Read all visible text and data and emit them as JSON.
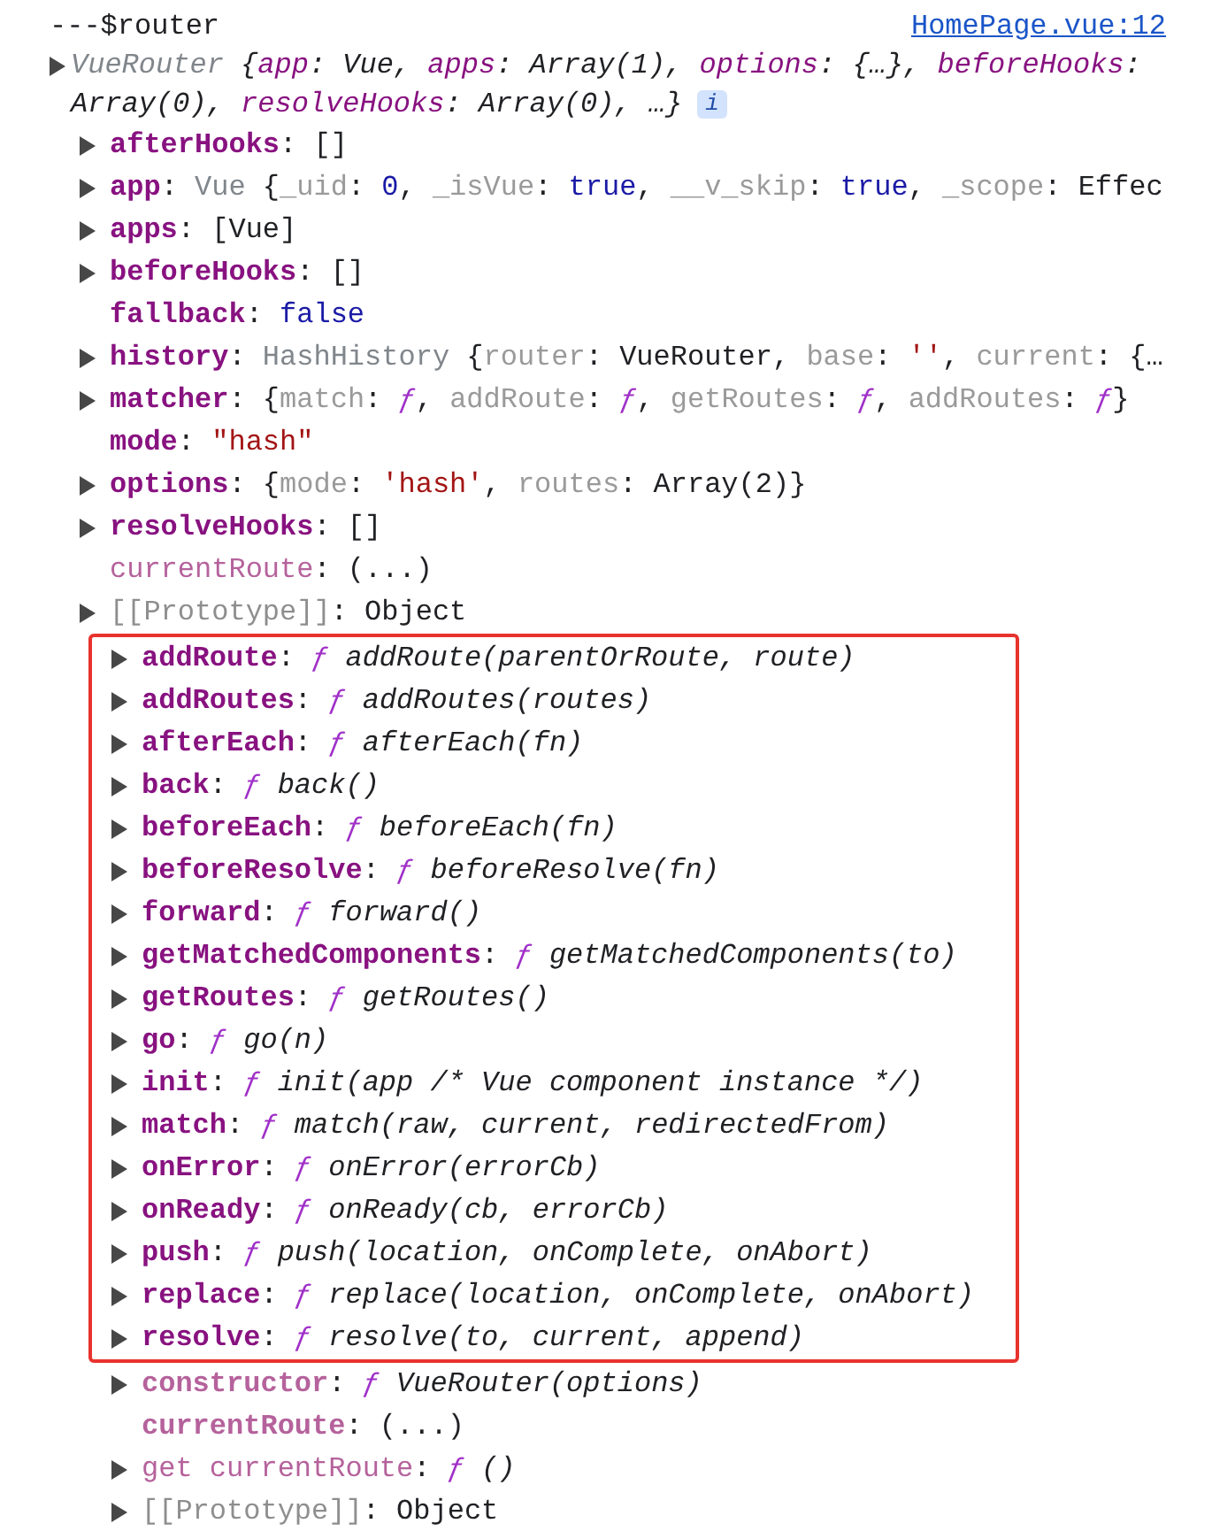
{
  "log": {
    "message": "---$router",
    "source": "HomePage.vue:12"
  },
  "object": {
    "preview_lines": [
      [
        {
          "kind": "t",
          "text": "VueRouter"
        },
        {
          "kind": "p",
          "text": " {"
        },
        {
          "kind": "pk",
          "text": "app"
        },
        {
          "kind": "p",
          "text": ": Vue, "
        },
        {
          "kind": "pk",
          "text": "apps"
        },
        {
          "kind": "p",
          "text": ": Array(1), "
        },
        {
          "kind": "pk",
          "text": "options"
        },
        {
          "kind": "p",
          "text": ": {…}, "
        },
        {
          "kind": "pk",
          "text": "beforeHooks"
        },
        {
          "kind": "p",
          "text": ":"
        }
      ],
      [
        {
          "kind": "p",
          "text": "Array(0), "
        },
        {
          "kind": "pk",
          "text": "resolveHooks"
        },
        {
          "kind": "p",
          "text": ": Array(0), …}"
        }
      ]
    ],
    "info_badge": "i",
    "children": [
      {
        "key": "afterHooks",
        "kind": "own",
        "expandable": true,
        "value": [
          {
            "kind": "p",
            "text": ": []"
          }
        ]
      },
      {
        "key": "app",
        "kind": "own",
        "expandable": true,
        "value": [
          {
            "kind": "p",
            "text": ": "
          },
          {
            "kind": "t",
            "text": "Vue"
          },
          {
            "kind": "p",
            "text": " {"
          },
          {
            "kind": "k",
            "text": "_uid"
          },
          {
            "kind": "p",
            "text": ": "
          },
          {
            "kind": "n",
            "text": "0"
          },
          {
            "kind": "p",
            "text": ", "
          },
          {
            "kind": "k",
            "text": "_isVue"
          },
          {
            "kind": "p",
            "text": ": "
          },
          {
            "kind": "n",
            "text": "true"
          },
          {
            "kind": "p",
            "text": ", "
          },
          {
            "kind": "k",
            "text": "__v_skip"
          },
          {
            "kind": "p",
            "text": ": "
          },
          {
            "kind": "n",
            "text": "true"
          },
          {
            "kind": "p",
            "text": ", "
          },
          {
            "kind": "k",
            "text": "_scope"
          },
          {
            "kind": "p",
            "text": ": Effec"
          }
        ]
      },
      {
        "key": "apps",
        "kind": "own",
        "expandable": true,
        "value": [
          {
            "kind": "p",
            "text": ": [Vue]"
          }
        ]
      },
      {
        "key": "beforeHooks",
        "kind": "own",
        "expandable": true,
        "value": [
          {
            "kind": "p",
            "text": ": []"
          }
        ]
      },
      {
        "key": "fallback",
        "kind": "own",
        "expandable": false,
        "value": [
          {
            "kind": "p",
            "text": ": "
          },
          {
            "kind": "n",
            "text": "false"
          }
        ]
      },
      {
        "key": "history",
        "kind": "own",
        "expandable": true,
        "value": [
          {
            "kind": "p",
            "text": ": "
          },
          {
            "kind": "t",
            "text": "HashHistory"
          },
          {
            "kind": "p",
            "text": " {"
          },
          {
            "kind": "k",
            "text": "router"
          },
          {
            "kind": "p",
            "text": ": VueRouter, "
          },
          {
            "kind": "k",
            "text": "base"
          },
          {
            "kind": "p",
            "text": ": "
          },
          {
            "kind": "s",
            "text": "''"
          },
          {
            "kind": "p",
            "text": ", "
          },
          {
            "kind": "k",
            "text": "current"
          },
          {
            "kind": "p",
            "text": ": {…"
          }
        ]
      },
      {
        "key": "matcher",
        "kind": "own",
        "expandable": true,
        "value": [
          {
            "kind": "p",
            "text": ": {"
          },
          {
            "kind": "k",
            "text": "match"
          },
          {
            "kind": "p",
            "text": ": "
          },
          {
            "kind": "f",
            "text": "ƒ"
          },
          {
            "kind": "p",
            "text": ", "
          },
          {
            "kind": "k",
            "text": "addRoute"
          },
          {
            "kind": "p",
            "text": ": "
          },
          {
            "kind": "f",
            "text": "ƒ"
          },
          {
            "kind": "p",
            "text": ", "
          },
          {
            "kind": "k",
            "text": "getRoutes"
          },
          {
            "kind": "p",
            "text": ": "
          },
          {
            "kind": "f",
            "text": "ƒ"
          },
          {
            "kind": "p",
            "text": ", "
          },
          {
            "kind": "k",
            "text": "addRoutes"
          },
          {
            "kind": "p",
            "text": ": "
          },
          {
            "kind": "f",
            "text": "ƒ"
          },
          {
            "kind": "p",
            "text": "}"
          }
        ]
      },
      {
        "key": "mode",
        "kind": "own",
        "expandable": false,
        "value": [
          {
            "kind": "p",
            "text": ": "
          },
          {
            "kind": "s",
            "text": "\"hash\""
          }
        ]
      },
      {
        "key": "options",
        "kind": "own",
        "expandable": true,
        "value": [
          {
            "kind": "p",
            "text": ": {"
          },
          {
            "kind": "k",
            "text": "mode"
          },
          {
            "kind": "p",
            "text": ": "
          },
          {
            "kind": "s",
            "text": "'hash'"
          },
          {
            "kind": "p",
            "text": ", "
          },
          {
            "kind": "k",
            "text": "routes"
          },
          {
            "kind": "p",
            "text": ": Array(2)}"
          }
        ]
      },
      {
        "key": "resolveHooks",
        "kind": "own",
        "expandable": true,
        "value": [
          {
            "kind": "p",
            "text": ": []"
          }
        ]
      },
      {
        "key": "currentRoute",
        "kind": "getter",
        "expandable": false,
        "value": [
          {
            "kind": "p",
            "text": ": (...)"
          }
        ]
      },
      {
        "key": "[[Prototype]]",
        "kind": "internal",
        "expandable": true,
        "value": [
          {
            "kind": "p",
            "text": ": Object"
          }
        ],
        "children": [
          {
            "key": "addRoute",
            "kind": "own",
            "expandable": true,
            "highlighted": true,
            "value": [
              {
                "kind": "p",
                "text": ": "
              },
              {
                "kind": "f",
                "text": "ƒ"
              },
              {
                "kind": "g",
                "text": " addRoute(parentOrRoute, route)"
              }
            ]
          },
          {
            "key": "addRoutes",
            "kind": "own",
            "expandable": true,
            "highlighted": true,
            "value": [
              {
                "kind": "p",
                "text": ": "
              },
              {
                "kind": "f",
                "text": "ƒ"
              },
              {
                "kind": "g",
                "text": " addRoutes(routes)"
              }
            ]
          },
          {
            "key": "afterEach",
            "kind": "own",
            "expandable": true,
            "highlighted": true,
            "value": [
              {
                "kind": "p",
                "text": ": "
              },
              {
                "kind": "f",
                "text": "ƒ"
              },
              {
                "kind": "g",
                "text": " afterEach(fn)"
              }
            ]
          },
          {
            "key": "back",
            "kind": "own",
            "expandable": true,
            "highlighted": true,
            "value": [
              {
                "kind": "p",
                "text": ": "
              },
              {
                "kind": "f",
                "text": "ƒ"
              },
              {
                "kind": "g",
                "text": " back()"
              }
            ]
          },
          {
            "key": "beforeEach",
            "kind": "own",
            "expandable": true,
            "highlighted": true,
            "value": [
              {
                "kind": "p",
                "text": ": "
              },
              {
                "kind": "f",
                "text": "ƒ"
              },
              {
                "kind": "g",
                "text": " beforeEach(fn)"
              }
            ]
          },
          {
            "key": "beforeResolve",
            "kind": "own",
            "expandable": true,
            "highlighted": true,
            "value": [
              {
                "kind": "p",
                "text": ": "
              },
              {
                "kind": "f",
                "text": "ƒ"
              },
              {
                "kind": "g",
                "text": " beforeResolve(fn)"
              }
            ]
          },
          {
            "key": "forward",
            "kind": "own",
            "expandable": true,
            "highlighted": true,
            "value": [
              {
                "kind": "p",
                "text": ": "
              },
              {
                "kind": "f",
                "text": "ƒ"
              },
              {
                "kind": "g",
                "text": " forward()"
              }
            ]
          },
          {
            "key": "getMatchedComponents",
            "kind": "own",
            "expandable": true,
            "highlighted": true,
            "value": [
              {
                "kind": "p",
                "text": ": "
              },
              {
                "kind": "f",
                "text": "ƒ"
              },
              {
                "kind": "g",
                "text": " getMatchedComponents(to)"
              }
            ]
          },
          {
            "key": "getRoutes",
            "kind": "own",
            "expandable": true,
            "highlighted": true,
            "value": [
              {
                "kind": "p",
                "text": ": "
              },
              {
                "kind": "f",
                "text": "ƒ"
              },
              {
                "kind": "g",
                "text": " getRoutes()"
              }
            ]
          },
          {
            "key": "go",
            "kind": "own",
            "expandable": true,
            "highlighted": true,
            "value": [
              {
                "kind": "p",
                "text": ": "
              },
              {
                "kind": "f",
                "text": "ƒ"
              },
              {
                "kind": "g",
                "text": " go(n)"
              }
            ]
          },
          {
            "key": "init",
            "kind": "own",
            "expandable": true,
            "highlighted": true,
            "value": [
              {
                "kind": "p",
                "text": ": "
              },
              {
                "kind": "f",
                "text": "ƒ"
              },
              {
                "kind": "g",
                "text": " init(app /* Vue component instance */)"
              }
            ]
          },
          {
            "key": "match",
            "kind": "own",
            "expandable": true,
            "highlighted": true,
            "value": [
              {
                "kind": "p",
                "text": ": "
              },
              {
                "kind": "f",
                "text": "ƒ"
              },
              {
                "kind": "g",
                "text": " match(raw, current, redirectedFrom)"
              }
            ]
          },
          {
            "key": "onError",
            "kind": "own",
            "expandable": true,
            "highlighted": true,
            "value": [
              {
                "kind": "p",
                "text": ": "
              },
              {
                "kind": "f",
                "text": "ƒ"
              },
              {
                "kind": "g",
                "text": " onError(errorCb)"
              }
            ]
          },
          {
            "key": "onReady",
            "kind": "own",
            "expandable": true,
            "highlighted": true,
            "value": [
              {
                "kind": "p",
                "text": ": "
              },
              {
                "kind": "f",
                "text": "ƒ"
              },
              {
                "kind": "g",
                "text": " onReady(cb, errorCb)"
              }
            ]
          },
          {
            "key": "push",
            "kind": "own",
            "expandable": true,
            "highlighted": true,
            "value": [
              {
                "kind": "p",
                "text": ": "
              },
              {
                "kind": "f",
                "text": "ƒ"
              },
              {
                "kind": "g",
                "text": " push(location, onComplete, onAbort)"
              }
            ]
          },
          {
            "key": "replace",
            "kind": "own",
            "expandable": true,
            "highlighted": true,
            "value": [
              {
                "kind": "p",
                "text": ": "
              },
              {
                "kind": "f",
                "text": "ƒ"
              },
              {
                "kind": "g",
                "text": " replace(location, onComplete, onAbort)"
              }
            ]
          },
          {
            "key": "resolve",
            "kind": "own",
            "expandable": true,
            "highlighted": true,
            "value": [
              {
                "kind": "p",
                "text": ": "
              },
              {
                "kind": "f",
                "text": "ƒ"
              },
              {
                "kind": "g",
                "text": " resolve(to, current, append)"
              }
            ]
          },
          {
            "key": "constructor",
            "kind": "inherited",
            "expandable": true,
            "highlighted": false,
            "value": [
              {
                "kind": "p",
                "text": ": "
              },
              {
                "kind": "f",
                "text": "ƒ"
              },
              {
                "kind": "g",
                "text": " VueRouter(options)"
              }
            ]
          },
          {
            "key": "currentRoute",
            "kind": "inherited",
            "expandable": false,
            "highlighted": false,
            "value": [
              {
                "kind": "p",
                "text": ": (...)"
              }
            ]
          },
          {
            "key": "get currentRoute",
            "kind": "getter",
            "expandable": true,
            "highlighted": false,
            "value": [
              {
                "kind": "p",
                "text": ": "
              },
              {
                "kind": "f",
                "text": "ƒ"
              },
              {
                "kind": "g",
                "text": " ()"
              }
            ]
          },
          {
            "key": "[[Prototype]]",
            "kind": "internal",
            "expandable": true,
            "highlighted": false,
            "value": [
              {
                "kind": "p",
                "text": ": Object"
              }
            ]
          }
        ]
      }
    ]
  }
}
